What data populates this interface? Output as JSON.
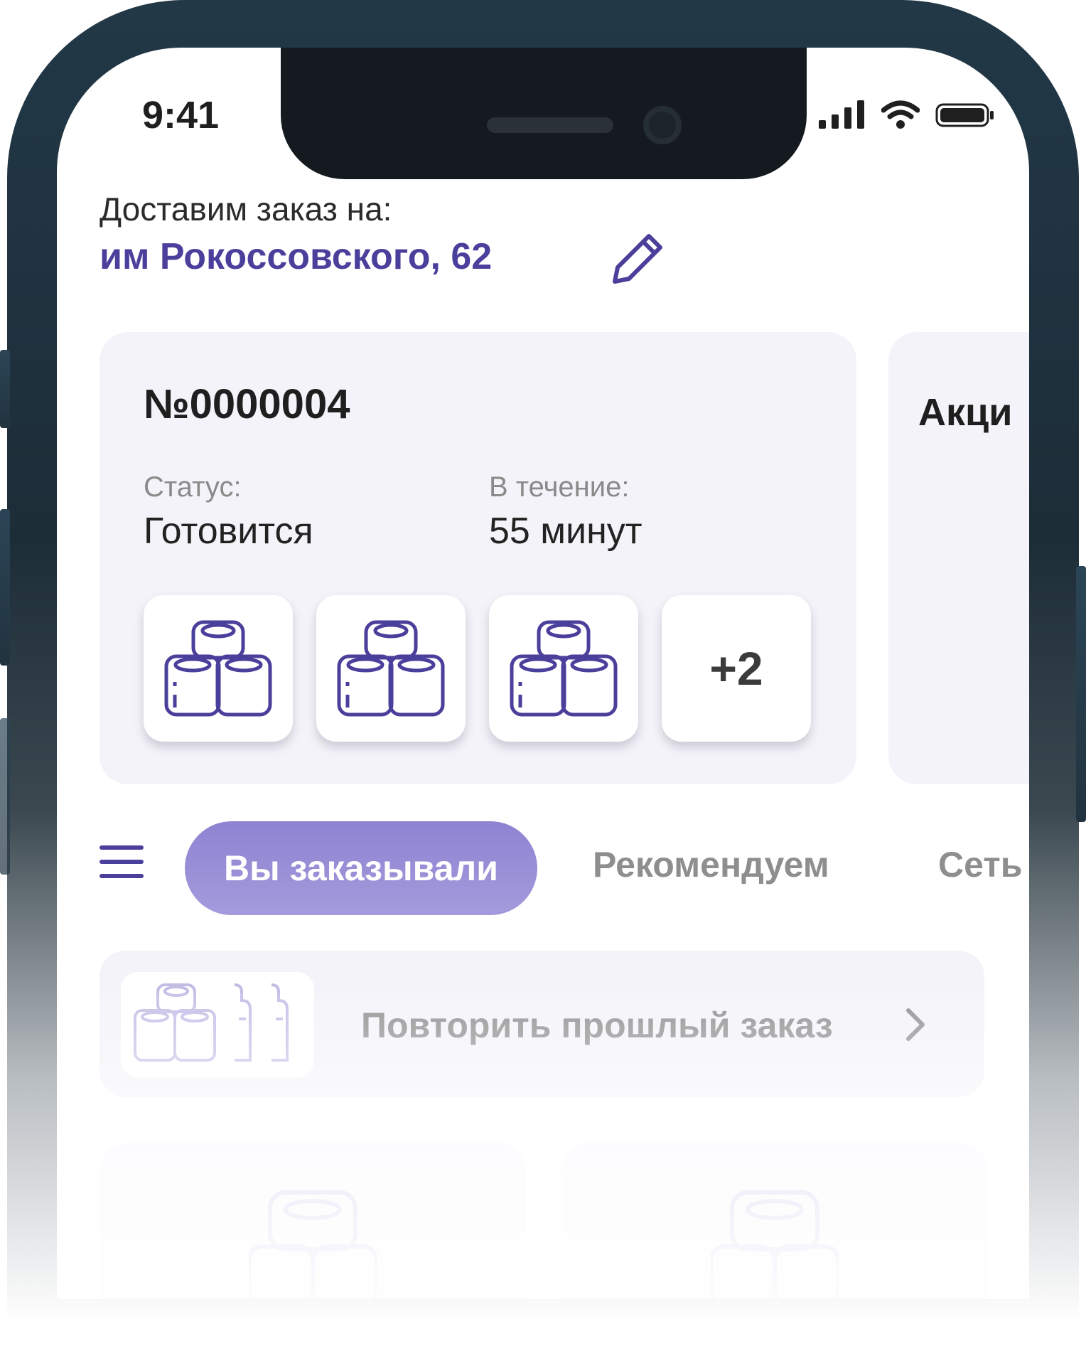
{
  "status_bar": {
    "time": "9:41"
  },
  "delivery": {
    "label": "Доставим заказ на:",
    "address": "им Рокоссовского, 62"
  },
  "order": {
    "number": "№0000004",
    "status_label": "Статус:",
    "status_value": "Готовится",
    "eta_label": "В течение:",
    "eta_value": "55 минут",
    "more_items": "+2",
    "item_icons": [
      "toilet-paper-icon",
      "toilet-paper-icon",
      "toilet-paper-icon"
    ]
  },
  "promo": {
    "title": "Акци"
  },
  "tabs": {
    "active": "Вы заказывали",
    "recommended": "Рекомендуем",
    "chains": "Сеть"
  },
  "repeat_order": {
    "label": "Повторить прошлый заказ"
  },
  "colors": {
    "accent": "#4b3f9c",
    "tab_active": "#958bd6",
    "card_bg": "#f4f3f9"
  }
}
